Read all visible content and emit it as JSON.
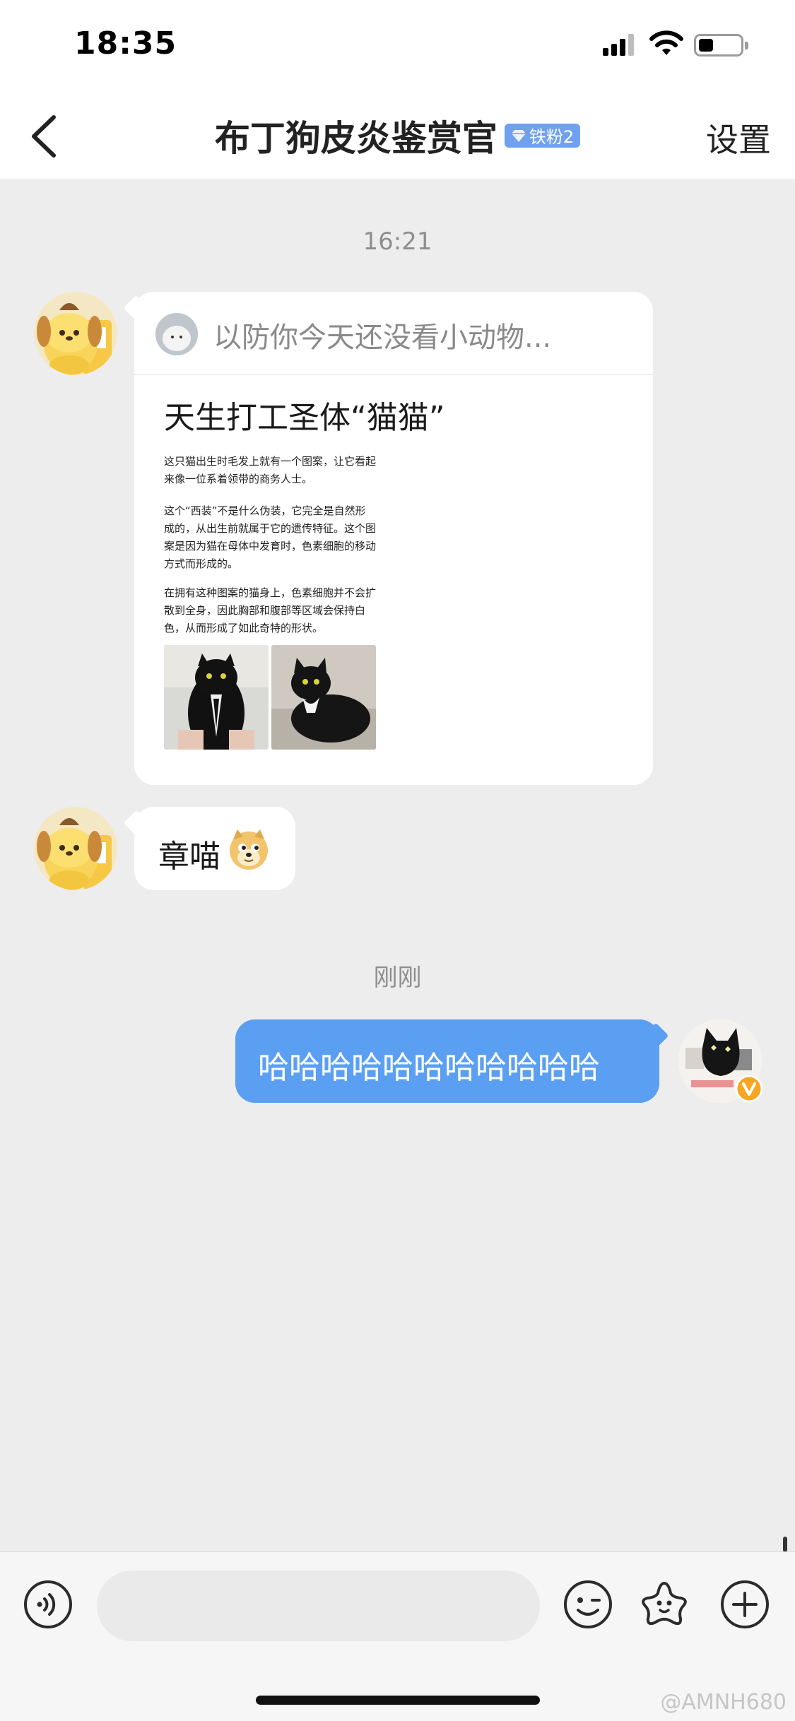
{
  "status_bar": {
    "time": "18:35",
    "signal_icon": "cellular-signal-icon",
    "wifi_icon": "wifi-icon",
    "battery_icon": "battery-icon"
  },
  "nav": {
    "back_icon": "chevron-left-icon",
    "title": "布丁狗皮炎鉴赏官",
    "fan_badge": "铁粉2",
    "settings_label": "设置"
  },
  "chat": {
    "timestamp_1": "16:21",
    "shared_card": {
      "source_text": "以防你今天还没看小动物...",
      "title": "天生打工圣体“猫猫”",
      "preview_paragraphs": [
        "这只猫出生时毛发上就有一个图案，让它看起来像一位系着领带的商务人士。",
        "这个“西装”不是什么伪装，它完全是自然形成的，从出生前就属于它的遗传特征。这个图案是因为猫在母体中发育时，色素细胞的移动方式而形成的。",
        "在拥有这种图案的猫身上，色素细胞并不会扩散到全身，因此胸部和腹部等区域会保持白色，从而形成了如此奇特的形状。"
      ]
    },
    "sticker_message": {
      "text": "章喵",
      "emoji_icon": "doge-emoji-icon"
    },
    "timestamp_2": "刚刚",
    "my_message": {
      "text": "哈哈哈哈哈哈哈哈哈哈哈"
    }
  },
  "input_bar": {
    "voice_icon": "voice-input-icon",
    "emoji_icon": "emoji-face-icon",
    "sticker_icon": "sticker-star-icon",
    "add_icon": "plus-circle-icon"
  },
  "watermark": "@AMNH680",
  "colors": {
    "accent_blue": "#5b9ff3",
    "chat_background": "#ededed",
    "fan_badge": "#6fa1ee"
  }
}
